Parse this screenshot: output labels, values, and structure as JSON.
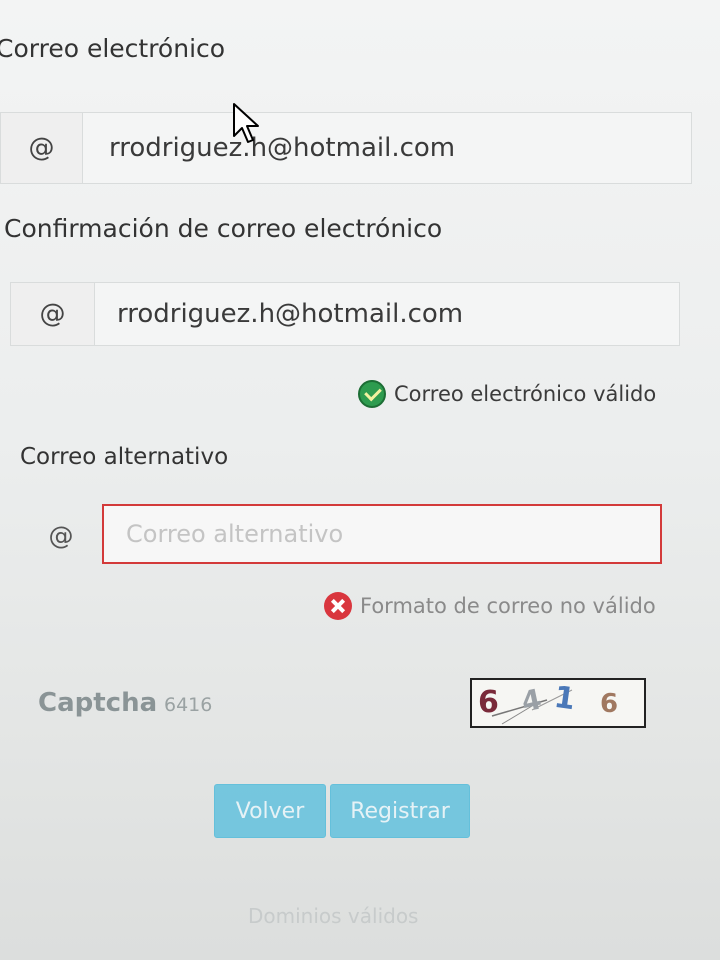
{
  "email": {
    "label": "Correo electrónico",
    "addon": "@",
    "value": "rrodriguez.h@hotmail.com"
  },
  "confirm_email": {
    "label": "Confirmación de correo electrónico",
    "addon": "@",
    "value": "rrodriguez.h@hotmail.com",
    "status": "Correo electrónico válido",
    "status_icon": "check-circle-icon"
  },
  "alt_email": {
    "label": "Correo alternativo",
    "addon": "@",
    "placeholder": "Correo alternativo",
    "status": "Formato de correo no válido",
    "status_icon": "error-circle-icon",
    "border_color": "#d33a3a"
  },
  "captcha": {
    "label": "Captcha",
    "hint": "6416",
    "image_text": "6416"
  },
  "buttons": {
    "back": "Volver",
    "register": "Registrar",
    "color": "#5bc0de"
  },
  "footer": {
    "link": "Dominios válidos"
  }
}
